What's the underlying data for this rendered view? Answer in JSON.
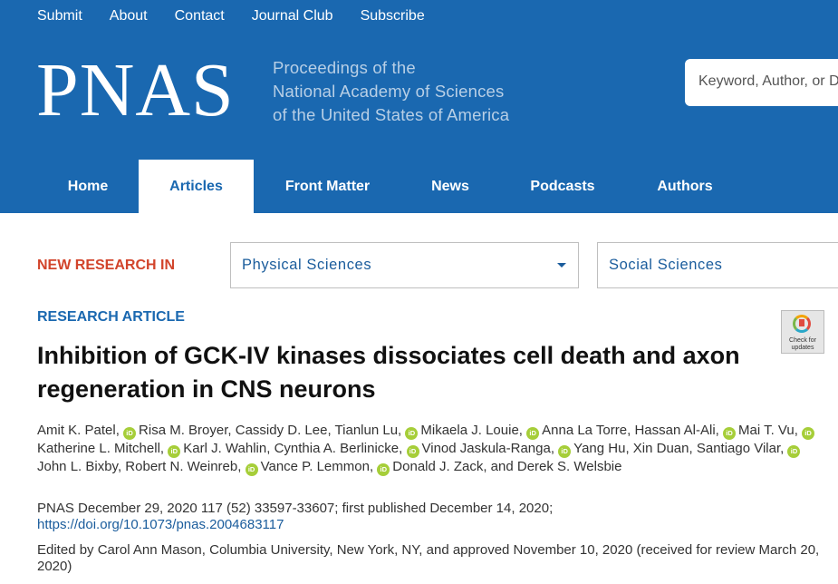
{
  "top_nav": [
    "Submit",
    "About",
    "Contact",
    "Journal Club",
    "Subscribe"
  ],
  "logo": "PNAS",
  "tagline": [
    "Proceedings of the",
    "National Academy of Sciences",
    "of the United States of America"
  ],
  "search": {
    "placeholder": "Keyword, Author, or DOI"
  },
  "main_nav": [
    {
      "label": "Home",
      "active": false
    },
    {
      "label": "Articles",
      "active": true
    },
    {
      "label": "Front Matter",
      "active": false
    },
    {
      "label": "News",
      "active": false
    },
    {
      "label": "Podcasts",
      "active": false
    },
    {
      "label": "Authors",
      "active": false
    }
  ],
  "new_research": {
    "label": "NEW RESEARCH IN",
    "selects": [
      "Physical Sciences",
      "Social Sciences"
    ]
  },
  "article": {
    "kicker": "RESEARCH ARTICLE",
    "title": "Inhibition of GCK-IV kinases dissociates cell death and axon regeneration in CNS neurons",
    "authors": [
      {
        "name": "Amit K. Patel",
        "orcid": false
      },
      {
        "name": "Risa M. Broyer",
        "orcid": true
      },
      {
        "name": "Cassidy D. Lee",
        "orcid": false
      },
      {
        "name": "Tianlun Lu",
        "orcid": false
      },
      {
        "name": "Mikaela J. Louie",
        "orcid": true
      },
      {
        "name": "Anna La Torre",
        "orcid": true
      },
      {
        "name": "Hassan Al-Ali",
        "orcid": false
      },
      {
        "name": "Mai T. Vu",
        "orcid": true
      },
      {
        "name": "Katherine L. Mitchell",
        "orcid": true
      },
      {
        "name": "Karl J. Wahlin",
        "orcid": true
      },
      {
        "name": "Cynthia A. Berlinicke",
        "orcid": false
      },
      {
        "name": "Vinod Jaskula-Ranga",
        "orcid": true
      },
      {
        "name": "Yang Hu",
        "orcid": true
      },
      {
        "name": "Xin Duan",
        "orcid": false
      },
      {
        "name": "Santiago Vilar",
        "orcid": false
      },
      {
        "name": "John L. Bixby",
        "orcid": true
      },
      {
        "name": "Robert N. Weinreb",
        "orcid": false
      },
      {
        "name": "Vance P. Lemmon",
        "orcid": true
      },
      {
        "name": "Donald J. Zack",
        "orcid": true
      },
      {
        "name": "Derek S. Welsbie",
        "orcid": false
      }
    ],
    "orcid_badge": "iD",
    "citation": "PNAS December 29, 2020 117 (52) 33597-33607; first published December 14, 2020;",
    "doi": "https://doi.org/10.1073/pnas.2004683117",
    "edited": "Edited by Carol Ann Mason, Columbia University, New York, NY, and approved November 10, 2020 (received for review March 20, 2020)"
  },
  "check_updates": "Check for updates",
  "colors": {
    "header_blue": "#1a68b0",
    "accent_red": "#d2442b",
    "orcid_green": "#a6ce39"
  }
}
